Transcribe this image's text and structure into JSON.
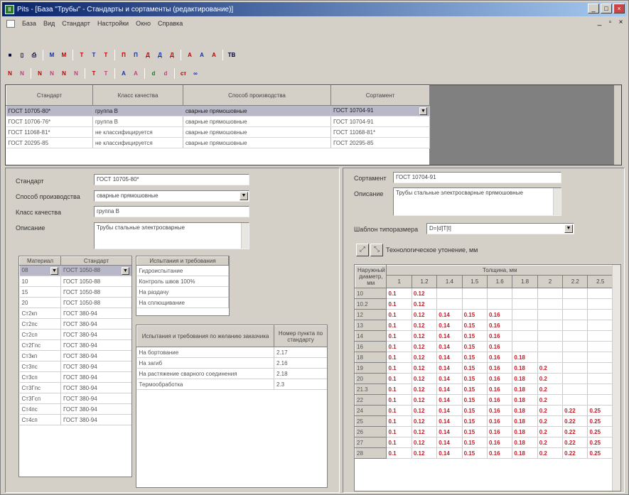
{
  "window": {
    "title": "Pits - [База \"Трубы\" - Стандарты и сортаменты (редактирование)]",
    "min": "_",
    "max": "□",
    "close": "×"
  },
  "menu": [
    "База",
    "Вид",
    "Стандарт",
    "Настройки",
    "Окно",
    "Справка"
  ],
  "mdi": {
    "min": "_",
    "restore": "▫",
    "close": "×"
  },
  "toolbar1": [
    {
      "t": "■",
      "c": "dk"
    },
    {
      "t": "▯",
      "c": "dk"
    },
    {
      "t": "⎙",
      "c": "dk"
    },
    {
      "t": "M",
      "c": "bl"
    },
    {
      "t": "M",
      "c": "rd"
    },
    {
      "t": "T",
      "c": "rd"
    },
    {
      "t": "T",
      "c": "bl"
    },
    {
      "t": "T",
      "c": "rd"
    },
    {
      "t": "Π",
      "c": "rd"
    },
    {
      "t": "Π",
      "c": "bl"
    },
    {
      "t": "Д",
      "c": "rd"
    },
    {
      "t": "Д",
      "c": "bl"
    },
    {
      "t": "Д",
      "c": "rd"
    },
    {
      "t": "A",
      "c": "rd"
    },
    {
      "t": "A",
      "c": "bl"
    },
    {
      "t": "A",
      "c": "rd"
    },
    {
      "t": "TB",
      "c": "dk"
    }
  ],
  "toolbar2": [
    {
      "t": "N",
      "c": "rd"
    },
    {
      "t": "N",
      "c": "pk"
    },
    {
      "t": "N",
      "c": "rd"
    },
    {
      "t": "N",
      "c": "pk"
    },
    {
      "t": "N",
      "c": "rd"
    },
    {
      "t": "N",
      "c": "pk"
    },
    {
      "t": "T",
      "c": "rd"
    },
    {
      "t": "T",
      "c": "pk"
    },
    {
      "t": "A",
      "c": "bl"
    },
    {
      "t": "A",
      "c": "pk"
    },
    {
      "t": "d",
      "c": "gr"
    },
    {
      "t": "d",
      "c": "pk"
    },
    {
      "t": "ст",
      "c": "rd"
    },
    {
      "t": "∞",
      "c": "bl"
    }
  ],
  "top_grid": {
    "headers": [
      "Стандарт",
      "Класс качества",
      "Способ производства",
      "Сортамент"
    ],
    "rows": [
      [
        "ГОСТ 10705-80*",
        "группа В",
        "сварные прямошовные",
        "ГОСТ 10704-91"
      ],
      [
        "ГОСТ 10706-76*",
        "группа В",
        "сварные прямошовные",
        "ГОСТ 10704-91"
      ],
      [
        "ГОСТ 11068-81*",
        "не классифицируется",
        "сварные прямошовные",
        "ГОСТ 11068-81*"
      ],
      [
        "ГОСТ 20295-85",
        "не классифицируется",
        "сварные прямошовные",
        "ГОСТ 20295-85"
      ]
    ],
    "selected": 0
  },
  "left": {
    "standard_label": "Стандарт",
    "standard_value": "ГОСТ 10705-80*",
    "method_label": "Способ производства",
    "method_value": "сварные прямошовные",
    "class_label": "Класс качества",
    "class_value": "группа В",
    "desc_label": "Описание",
    "desc_value": "Трубы стальные электросварные",
    "materials": {
      "headers": [
        "Материал",
        "Стандарт"
      ],
      "rows": [
        [
          "08",
          "ГОСТ 1050-88"
        ],
        [
          "10",
          "ГОСТ 1050-88"
        ],
        [
          "15",
          "ГОСТ 1050-88"
        ],
        [
          "20",
          "ГОСТ 1050-88"
        ],
        [
          "Ст2кп",
          "ГОСТ 380-94"
        ],
        [
          "Ст2пс",
          "ГОСТ 380-94"
        ],
        [
          "Ст2сп",
          "ГОСТ 380-94"
        ],
        [
          "Ст2Гпс",
          "ГОСТ 380-94"
        ],
        [
          "Ст3кп",
          "ГОСТ 380-94"
        ],
        [
          "Ст3пс",
          "ГОСТ 380-94"
        ],
        [
          "Ст3сп",
          "ГОСТ 380-94"
        ],
        [
          "Ст3Гпс",
          "ГОСТ 380-94"
        ],
        [
          "Ст3Гсп",
          "ГОСТ 380-94"
        ],
        [
          "Ст4пс",
          "ГОСТ 380-94"
        ],
        [
          "Ст4сп",
          "ГОСТ 380-94"
        ]
      ]
    },
    "tests1": {
      "header": "Испытания и требования",
      "rows": [
        "Гидроиспытание",
        "Контроль швов 100%",
        "На раздачу",
        "На сплющивание"
      ]
    },
    "tests2": {
      "headers": [
        "Испытания и требования по желанию заказчика",
        "Номер пункта по стандарту"
      ],
      "rows": [
        [
          "На бортование",
          "2.17"
        ],
        [
          "На загиб",
          "2.16"
        ],
        [
          "На растяжение сварного соединения",
          "2.18"
        ],
        [
          "Термообработка",
          "2.3"
        ]
      ]
    }
  },
  "right": {
    "sortament_label": "Сортамент",
    "sortament_value": "ГОСТ 10704-91",
    "desc_label": "Описание",
    "desc_value": "Трубы стальные электросварные прямошовные",
    "template_label": "Шаблон типоразмера",
    "template_value": "D=[d]T[t]",
    "tech_label": "Технологическое утонение, мм",
    "dia_header": "Наружный диаметр, мм",
    "thick_header": "Толщина, мм",
    "thicknesses": [
      "1",
      "1.2",
      "1.4",
      "1.5",
      "1.6",
      "1.8",
      "2",
      "2.2",
      "2.5"
    ],
    "rows": [
      [
        "10",
        [
          "0.1",
          "0.12",
          "",
          "",
          "",
          "",
          "",
          "",
          ""
        ]
      ],
      [
        "10.2",
        [
          "0.1",
          "0.12",
          "",
          "",
          "",
          "",
          "",
          "",
          ""
        ]
      ],
      [
        "12",
        [
          "0.1",
          "0.12",
          "0.14",
          "0.15",
          "0.16",
          "",
          "",
          "",
          ""
        ]
      ],
      [
        "13",
        [
          "0.1",
          "0.12",
          "0.14",
          "0.15",
          "0.16",
          "",
          "",
          "",
          ""
        ]
      ],
      [
        "14",
        [
          "0.1",
          "0.12",
          "0.14",
          "0.15",
          "0.16",
          "",
          "",
          "",
          ""
        ]
      ],
      [
        "16",
        [
          "0.1",
          "0.12",
          "0.14",
          "0.15",
          "0.16",
          "",
          "",
          "",
          ""
        ]
      ],
      [
        "18",
        [
          "0.1",
          "0.12",
          "0.14",
          "0.15",
          "0.16",
          "0.18",
          "",
          "",
          ""
        ]
      ],
      [
        "19",
        [
          "0.1",
          "0.12",
          "0.14",
          "0.15",
          "0.16",
          "0.18",
          "0.2",
          "",
          ""
        ]
      ],
      [
        "20",
        [
          "0.1",
          "0.12",
          "0.14",
          "0.15",
          "0.16",
          "0.18",
          "0.2",
          "",
          ""
        ]
      ],
      [
        "21.3",
        [
          "0.1",
          "0.12",
          "0.14",
          "0.15",
          "0.16",
          "0.18",
          "0.2",
          "",
          ""
        ]
      ],
      [
        "22",
        [
          "0.1",
          "0.12",
          "0.14",
          "0.15",
          "0.16",
          "0.18",
          "0.2",
          "",
          ""
        ]
      ],
      [
        "24",
        [
          "0.1",
          "0.12",
          "0.14",
          "0.15",
          "0.16",
          "0.18",
          "0.2",
          "0.22",
          "0.25"
        ]
      ],
      [
        "25",
        [
          "0.1",
          "0.12",
          "0.14",
          "0.15",
          "0.16",
          "0.18",
          "0.2",
          "0.22",
          "0.25"
        ]
      ],
      [
        "26",
        [
          "0.1",
          "0.12",
          "0.14",
          "0.15",
          "0.16",
          "0.18",
          "0.2",
          "0.22",
          "0.25"
        ]
      ],
      [
        "27",
        [
          "0.1",
          "0.12",
          "0.14",
          "0.15",
          "0.16",
          "0.18",
          "0.2",
          "0.22",
          "0.25"
        ]
      ],
      [
        "28",
        [
          "0.1",
          "0.12",
          "0.14",
          "0.15",
          "0.16",
          "0.18",
          "0.2",
          "0.22",
          "0.25"
        ]
      ]
    ]
  }
}
